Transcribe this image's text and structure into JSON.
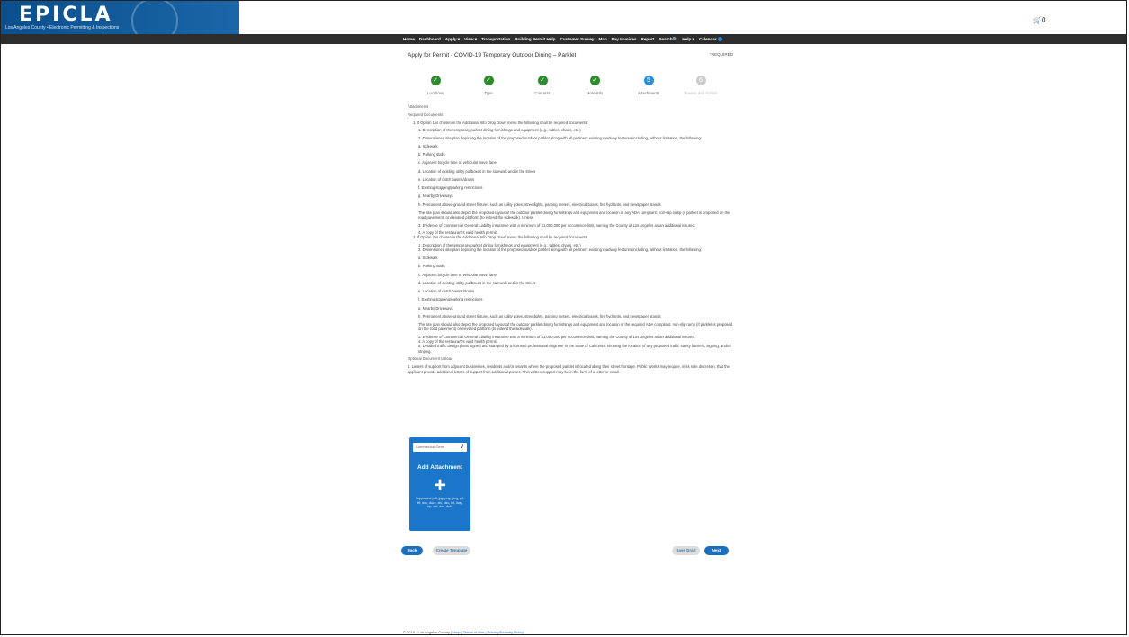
{
  "header": {
    "logo_text": "EPICLA",
    "logo_sub": "Los Angeles County • Electronic Permitting & Inspections",
    "cart_icon": "cart-icon",
    "cart_count": "0"
  },
  "nav": {
    "items": [
      "Home",
      "Dashboard",
      "Apply ▾",
      "View ▾",
      "Transportation",
      "Building Permit Help",
      "Customer Survey",
      "Map",
      "Pay Invoices",
      "Report",
      "Search",
      "Help ▾",
      "Calendar"
    ]
  },
  "page": {
    "title": "Apply for Permit - COVID-19 Temporary Outdoor Dining – Parklet",
    "required": "*REQUIRED"
  },
  "steps": [
    {
      "label": "Locations",
      "state": "done",
      "mark": "✓"
    },
    {
      "label": "Type",
      "state": "done",
      "mark": "✓"
    },
    {
      "label": "Contacts",
      "state": "done",
      "mark": "✓"
    },
    {
      "label": "More Info",
      "state": "done",
      "mark": "✓"
    },
    {
      "label": "Attachments",
      "state": "current",
      "mark": "5"
    },
    {
      "label": "Review and Submit",
      "state": "pending",
      "mark": "6"
    }
  ],
  "doc": {
    "attachments_heading": "Attachments",
    "required_heading": "Required Documents",
    "opt1_intro": "1. If Option 1 is chosen in the Additional Info Drop Down menu the following shall be required documents:",
    "o1_1": "1. Description of the temporary parklet dining furnishings and equipment (e.g., tables, chairs, etc.)",
    "o1_2": "2. Dimensioned site plan depicting the location of the proposed outdoor parklet along with all pertinent existing roadway features including, without limitation, the following:",
    "o1_a": "a. Sidewalk",
    "o1_b": "b. Parking stalls",
    "o1_c": "c. Adjacent bicycle lane or vehicular travel lane",
    "o1_d": "d. Location of existing utility pullboxes in the sidewalk and in the street",
    "o1_e": "e. Location of catch basins/drains",
    "o1_f": "f. Existing stopping/parking restrictions",
    "o1_g": "g. Nearby Driveways",
    "o1_h": "h. Permanent above-ground street fixtures such as utility poles, streetlights, parking meters, electrical boxes, fire hydrants, and newspaper stands",
    "o1_site": "The site plan should also depict the proposed layout of the outdoor parklet dining furnishings and equipment and location of any ADA compliant, non-slip ramp (if parklet is proposed on the road pavement) or elevated platform (to extend the sidewalk). Unless",
    "o1_3": "3. Evidence of Commercial General Liability insurance with a minimum of $1,000,000 per occurrence limit, naming the County of Los Angeles as an additional insured.",
    "o1_4": "4. A copy of the restaurant's valid health permit.",
    "opt2_intro": "2. If Option 2 is chosen in the Additional Info Drop Down menu the following shall be required documents.",
    "o2_1": "1. Description of the temporary parklet dining furnishings and equipment (e.g., tables, chairs, etc.)",
    "o2_2": "2. Dimensioned site plan depicting the location of the proposed outdoor parklet along with all pertinent existing roadway features including, without limitation, the following:",
    "o2_a": "a. Sidewalk",
    "o2_b": "b. Parking stalls",
    "o2_c": "c. Adjacent bicycle lane or vehicular travel lane",
    "o2_d": "d. Location of existing utility pullboxes in the sidewalk and in the street",
    "o2_e": "e. Location of catch basins/drains",
    "o2_f": "f. Existing stopping/parking restrictions",
    "o2_g": "g. Nearby Driveways",
    "o2_h": "h. Permanent above-ground street fixtures such as utility poles, streetlights, parking meters, electrical boxes, fire hydrants, and newspaper stands",
    "o2_site": "The site plan should also depict the proposed layout of the outdoor parklet dining furnishings and equipment and location of the required ADA compliant, non-slip ramp (if parklet is proposed on the road pavement) or elevated platform (to extend the sidewalk).",
    "o2_3": "3. Evidence of Commercial General Liability insurance with a minimum of $1,000,000 per occurrence limit, naming the County of Los Angeles as an additional insured.",
    "o2_4": "4. A copy of the restaurant's valid health permit.",
    "o2_5": "5. Detailed traffic design plans signed and stamped by a licensed professional engineer in the State of California, showing the location of any proposed traffic safety barriers, signing, and/or striping.",
    "optional_heading": "Optional Document Upload",
    "optional_1": "1. Letters of support from adjacent businesses, residents and/or tenants where the proposed parklet is located along their street frontage. Public Works may require, in its sole discretion, that the applicant provide additional letters of support from additional parties. This written support may be in the form of a letter or email."
  },
  "upload": {
    "select_value": "Commercial Gene",
    "title": "Add Attachment",
    "plus": "+",
    "note": "Supported: pdf, jpg, png, jpeg, gif, tiff, doc, docx, xls, xlsx, txt, dwg, zip, dxf, dwf, dwfx"
  },
  "buttons": {
    "back": "Back",
    "create_template": "Create Template",
    "save_draft": "Save Draft",
    "next": "Next"
  },
  "footer": {
    "copyright": "© 2019 - Los Angeles County",
    "help": "Help",
    "terms": "Terms of Use",
    "privacy": "Privacy/Security Policy"
  }
}
